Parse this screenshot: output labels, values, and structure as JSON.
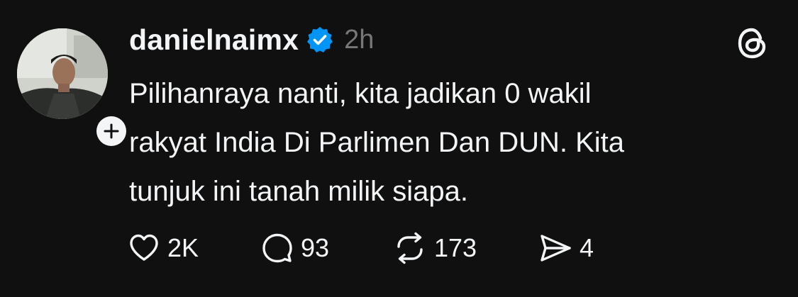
{
  "post": {
    "author": {
      "username": "danielnaimx",
      "verified": true,
      "avatar_icon": "profile-photo"
    },
    "timestamp": "2h",
    "text_lines": [
      "Pilihanraya nanti, kita jadikan 0 wakil",
      "rakyat India Di Parlimen Dan DUN. Kita",
      "tunjuk ini tanah milik siapa."
    ],
    "actions": {
      "like": {
        "icon": "heart-icon",
        "count": "2K"
      },
      "reply": {
        "icon": "comment-icon",
        "count": "93"
      },
      "repost": {
        "icon": "repost-icon",
        "count": "173"
      },
      "share": {
        "icon": "send-icon",
        "count": "4"
      }
    }
  },
  "app": {
    "logo_icon": "threads-logo-icon"
  },
  "colors": {
    "background": "#101010",
    "text": "#f3f5f7",
    "secondary": "#777777",
    "verified_blue": "#0095f6"
  }
}
